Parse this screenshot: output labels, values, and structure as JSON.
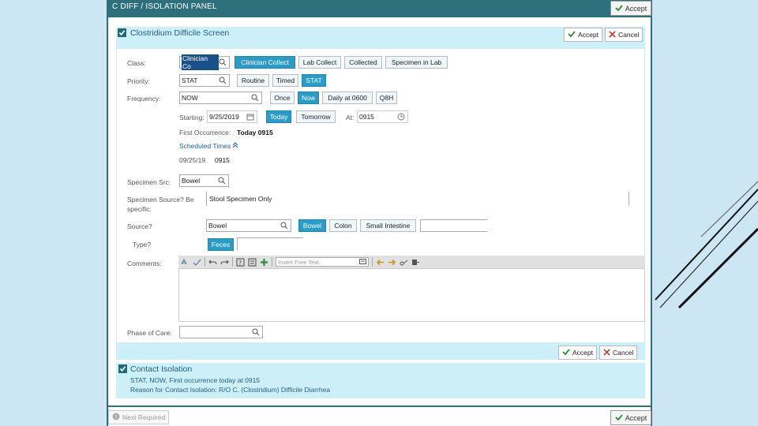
{
  "panel": {
    "title": "C DIFF / ISOLATION PANEL",
    "top_accept": "Accept",
    "next_required": "Next Required",
    "bottom_accept": "Accept"
  },
  "cdiff": {
    "header": "Clostridium Difficile Screen",
    "accept": "Accept",
    "cancel": "Cancel",
    "class_label": "Class:",
    "class_value": "Clinician Co",
    "class_options": [
      "Clinician Collect",
      "Lab Collect",
      "Collected",
      "Specimen in Lab"
    ],
    "priority_label": "Priority:",
    "priority_value": "STAT",
    "priority_options": [
      "Routine",
      "Timed",
      "STAT"
    ],
    "frequency_label": "Frequency:",
    "frequency_value": "NOW",
    "frequency_options": [
      "Once",
      "Now",
      "Daily at 0600",
      "Q8H"
    ],
    "starting_label": "Starting:",
    "starting_value": "9/25/2019",
    "starting_options": [
      "Today",
      "Tomorrow"
    ],
    "at_label": "At:",
    "at_value": "0915",
    "first_occurrence_label": "First Occurrence:",
    "first_occurrence_value": "Today 0915",
    "scheduled_times_label": "Scheduled Times",
    "scheduled_date": "09/25/19",
    "scheduled_time": "0915",
    "specimen_src_label": "Specimen Src:",
    "specimen_src_value": "Bowel",
    "specimen_source_label_1": "Specimen Source? Be",
    "specimen_source_label_2": "specific:",
    "specimen_source_value": "Stool Specimen Only",
    "source_label": "Source?",
    "source_value": "Bowel",
    "source_options": [
      "Bowel",
      "Colon",
      "Small Intestine"
    ],
    "type_label": "Type?",
    "type_option": "Feces",
    "comments_label": "Comments:",
    "insert_freetext_placeholder": "Insert Free Text",
    "phase_label": "Phase of Care:",
    "bottom_accept": "Accept",
    "bottom_cancel": "Cancel"
  },
  "contact": {
    "header": "Contact Isolation",
    "line1": "STAT, NOW, First occurrence today at 0915",
    "line2": "Reason for Contact Isolation: R/O C. (Clostridium) Difficile Diarrhea"
  },
  "colors": {
    "panel_teal": "#2d6f7b",
    "selected_blue": "#2a9cc8",
    "section_bg": "#cdeff7",
    "page_bg": "#cde6f4"
  }
}
